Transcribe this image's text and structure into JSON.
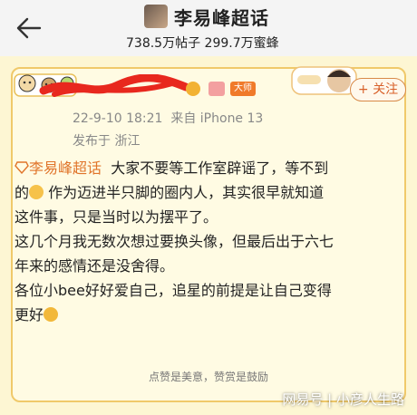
{
  "header": {
    "title": "李易峰超话",
    "posts_count": "738.5万帖子",
    "bees_count": "299.7万蜜蜂"
  },
  "post": {
    "badge_text": "大师",
    "follow_label": "+ 关注",
    "timestamp": "22-9-10 18:21",
    "source": "来自 iPhone 13",
    "location": "发布于 浙江",
    "topic": "李易峰超话",
    "line1": "大家不要等工作室辟谣了，等不到",
    "line2a": "的",
    "line2b": "作为迈进半只脚的圈内人，其实很早就知道",
    "line3": "这件事，只是当时以为摆平了。",
    "line4": "这几个月我无数次想过要换头像，但最后出于六七",
    "line5": "年来的感情还是没舍得。",
    "line6": "各位小bee好好爱自己，追星的前提是让自己变得",
    "line7": "更好"
  },
  "footer": {
    "reward_text": "点赞是美意，赞赏是鼓励"
  },
  "watermark": {
    "text": "网易号 | 小彦人生路"
  },
  "colors": {
    "topic": "#e0742a",
    "card_bg": "#fdf6d3",
    "border": "#f0c96a",
    "redaction": "#e8281e"
  }
}
